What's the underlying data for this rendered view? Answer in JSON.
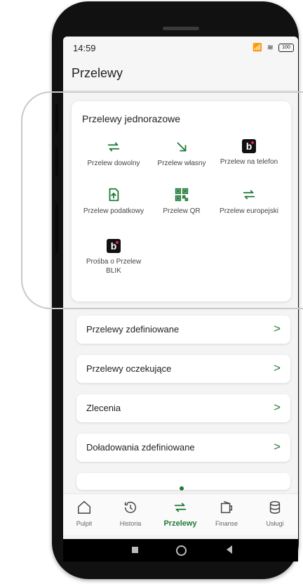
{
  "status": {
    "time": "14:59",
    "icons": "📶 ≋",
    "battery": "100"
  },
  "header": {
    "title": "Przelewy"
  },
  "card": {
    "title": "Przelewy jednorazowe",
    "tiles": [
      {
        "label": "Przelew dowolny",
        "icon": "transfer-arrows-icon"
      },
      {
        "label": "Przelew własny",
        "icon": "arrow-down-right-icon"
      },
      {
        "label": "Przelew na telefon",
        "icon": "blik-icon"
      },
      {
        "label": "Przelew podatkowy",
        "icon": "tax-document-icon"
      },
      {
        "label": "Przelew QR",
        "icon": "qr-code-icon"
      },
      {
        "label": "Przelew europejski",
        "icon": "transfer-arrows-icon"
      },
      {
        "label": "Prośba o Przelew BLIK",
        "icon": "blik-icon"
      }
    ]
  },
  "menu": [
    {
      "label": "Przelewy zdefiniowane"
    },
    {
      "label": "Przelewy oczekujące"
    },
    {
      "label": "Zlecenia"
    },
    {
      "label": "Doładowania zdefiniowane"
    }
  ],
  "chevron": ">",
  "nav": [
    {
      "label": "Pulpit",
      "icon": "home-icon"
    },
    {
      "label": "Historia",
      "icon": "history-icon"
    },
    {
      "label": "Przelewy",
      "icon": "transfer-icon",
      "active": true
    },
    {
      "label": "Finanse",
      "icon": "wallet-icon"
    },
    {
      "label": "Usługi",
      "icon": "database-icon"
    }
  ],
  "colors": {
    "accent": "#1f7a35",
    "chevron": "#2e7d3a"
  }
}
